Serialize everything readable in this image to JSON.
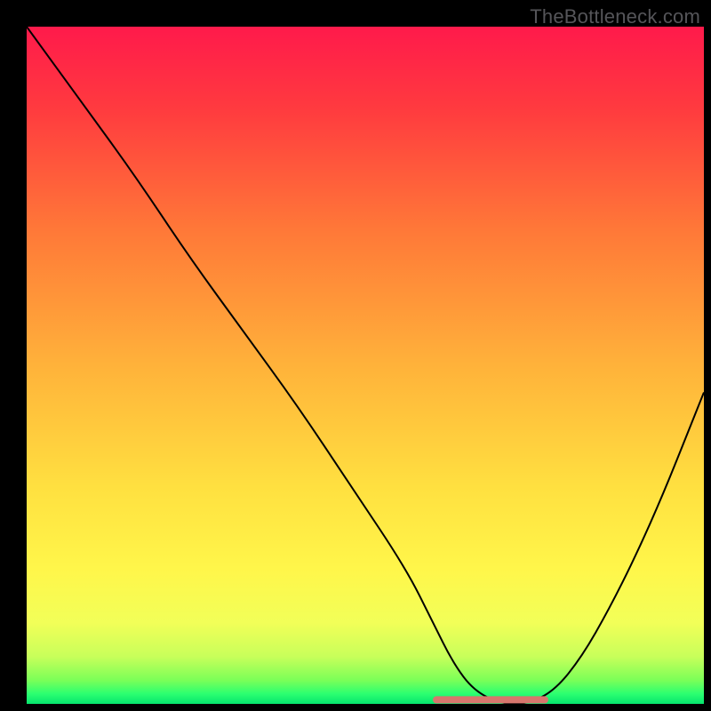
{
  "watermark": "TheBottleneck.com",
  "chart_data": {
    "type": "line",
    "title": "",
    "xlabel": "",
    "ylabel": "",
    "xlim": [
      0,
      100
    ],
    "ylim": [
      0,
      100
    ],
    "grid": false,
    "series": [
      {
        "name": "curve",
        "x": [
          0,
          8,
          16,
          24,
          32,
          40,
          48,
          56,
          60,
          63,
          66,
          70,
          74,
          78,
          82,
          86,
          90,
          94,
          98,
          100
        ],
        "y": [
          100,
          89,
          78,
          66,
          55,
          44,
          32,
          20,
          12,
          6,
          2,
          0,
          0,
          2,
          7,
          14,
          22,
          31,
          41,
          46
        ],
        "stroke": "#000000",
        "strokeWidth": 2
      }
    ],
    "gradient_stops": [
      {
        "offset": 0.0,
        "color": "#ff1a4b"
      },
      {
        "offset": 0.12,
        "color": "#ff3a3f"
      },
      {
        "offset": 0.3,
        "color": "#ff7838"
      },
      {
        "offset": 0.5,
        "color": "#ffb23a"
      },
      {
        "offset": 0.68,
        "color": "#ffe040"
      },
      {
        "offset": 0.8,
        "color": "#fff64a"
      },
      {
        "offset": 0.88,
        "color": "#f2ff58"
      },
      {
        "offset": 0.93,
        "color": "#c8ff5a"
      },
      {
        "offset": 0.965,
        "color": "#7bff58"
      },
      {
        "offset": 0.985,
        "color": "#2cff70"
      },
      {
        "offset": 1.0,
        "color": "#06e56e"
      }
    ],
    "flat_segment": {
      "x0": 60.5,
      "x1": 76.5,
      "y": 0.6,
      "color": "#d8766d",
      "width": 8
    }
  }
}
